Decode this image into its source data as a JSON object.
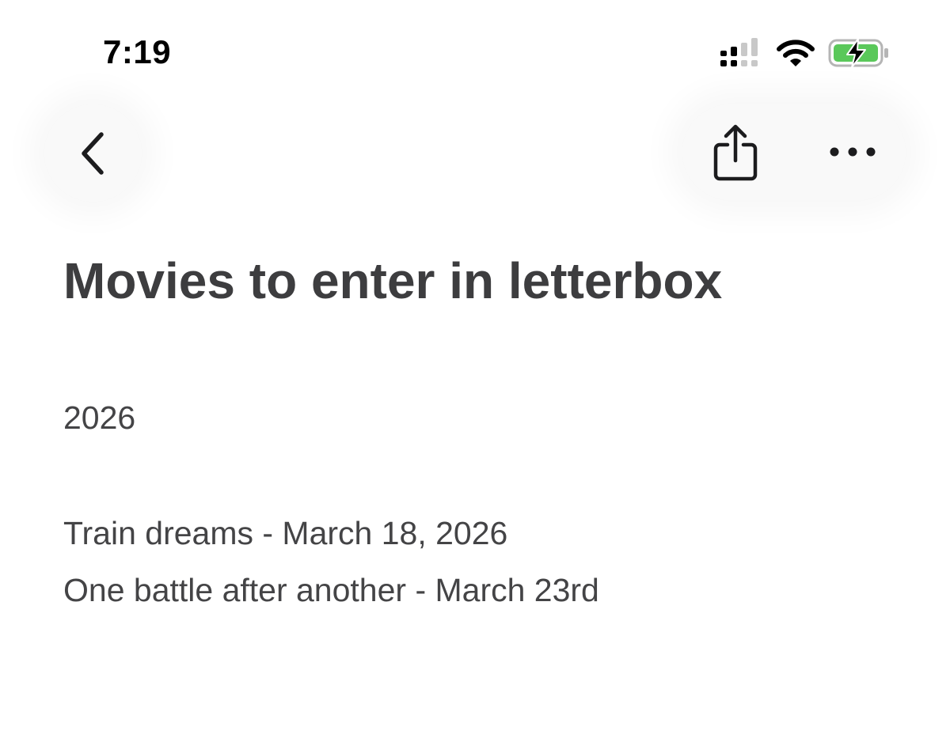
{
  "status_bar": {
    "time": "7:19",
    "icons": [
      "cellular-signal-icon",
      "wifi-icon",
      "battery-charging-icon"
    ],
    "battery_color": "#5ac85a"
  },
  "nav": {
    "back_icon": "chevron-left-icon",
    "share_icon": "share-icon",
    "more_icon": "ellipsis-icon"
  },
  "note": {
    "title": "Movies to enter in letterbox",
    "lines": [
      "2026",
      "Train dreams - March 18, 2026",
      "One battle after another - March 23rd"
    ]
  }
}
